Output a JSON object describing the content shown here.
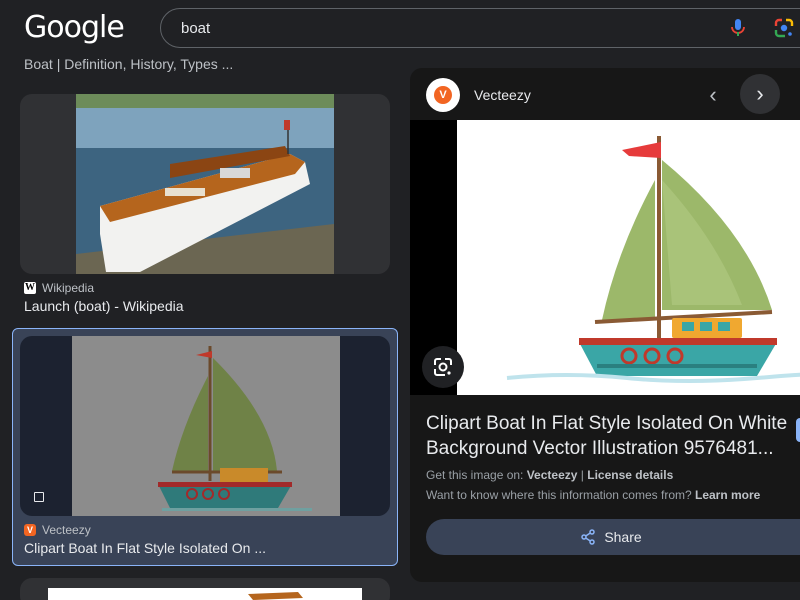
{
  "header": {
    "logo_text": "Google",
    "search_value": "boat",
    "mic_icon": "mic-icon",
    "lens_icon": "google-lens-icon"
  },
  "results": {
    "top_caption": "Boat | Definition, History, Types ...",
    "item1": {
      "source": "Wikipedia",
      "favicon": "W",
      "title": "Launch (boat) - Wikipedia"
    },
    "item2": {
      "source": "Vecteezy",
      "favicon": "V",
      "title": "Clipart Boat In Flat Style Isolated On ..."
    }
  },
  "panel": {
    "site_name": "Vecteezy",
    "logo_letter": "V",
    "prev_glyph": "‹",
    "next_glyph": "›",
    "title_line1": "Clipart Boat In Flat Style Isolated On White",
    "title_line2": "Background Vector Illustration 9576481...",
    "get_image_prefix": "Get this image on: ",
    "get_image_site": "Vecteezy",
    "separator": " | ",
    "license_link": "License details",
    "want_to_know": "Want to know where this information comes from? ",
    "learn_more": "Learn more",
    "share_label": "Share"
  },
  "colors": {
    "background": "#202124",
    "accent_blue": "#8ab4f8",
    "vecteezy_orange": "#f26522",
    "sail_green": "#9cb86a",
    "hull_teal": "#3aa6a6"
  }
}
